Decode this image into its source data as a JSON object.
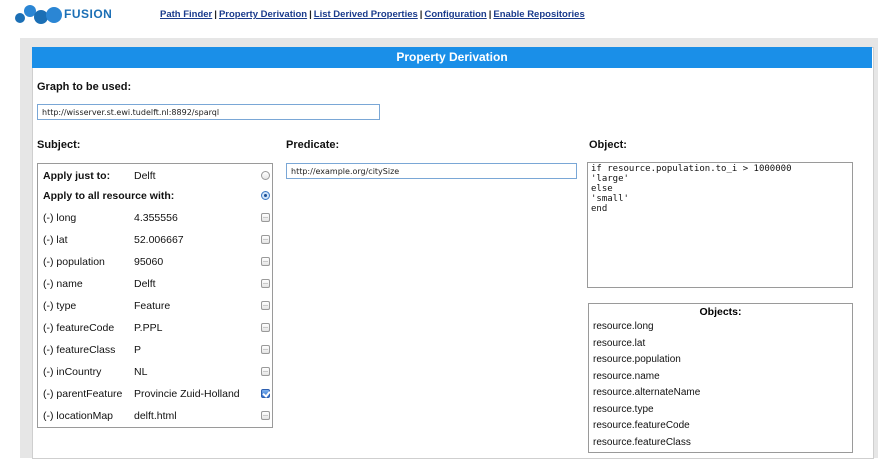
{
  "app": {
    "logo_text": "FUSION",
    "brand_color": "#1b6fb5"
  },
  "nav": {
    "items": [
      {
        "label": "Path Finder"
      },
      {
        "label": "Property Derivation"
      },
      {
        "label": "List Derived Properties"
      },
      {
        "label": "Configuration"
      },
      {
        "label": "Enable Repositories"
      }
    ],
    "separator": "|"
  },
  "panel": {
    "title": "Property Derivation",
    "accent": "#1a8fe8"
  },
  "graph": {
    "label": "Graph to be used:",
    "value": "http://wisserver.st.ewi.tudelft.nl:8892/sparql"
  },
  "subject": {
    "label": "Subject:",
    "apply_just_to": {
      "label": "Apply just to:",
      "value": "Delft",
      "selected": false
    },
    "apply_all": {
      "label": "Apply to all resource with:",
      "selected": true
    },
    "properties": [
      {
        "key": "(-) long",
        "value": "4.355556",
        "checked": false
      },
      {
        "key": "(-) lat",
        "value": "52.006667",
        "checked": false
      },
      {
        "key": "(-) population",
        "value": "95060",
        "checked": false
      },
      {
        "key": "(-) name",
        "value": "Delft",
        "checked": false
      },
      {
        "key": "(-) type",
        "value": "Feature",
        "checked": false
      },
      {
        "key": "(-) featureCode",
        "value": "P.PPL",
        "checked": false
      },
      {
        "key": "(-) featureClass",
        "value": "P",
        "checked": false
      },
      {
        "key": "(-) inCountry",
        "value": "NL",
        "checked": false
      },
      {
        "key": "(-) parentFeature",
        "value": "Provincie Zuid-Holland",
        "checked": true
      },
      {
        "key": "(-) locationMap",
        "value": "delft.html",
        "checked": false
      }
    ]
  },
  "predicate": {
    "label": "Predicate:",
    "value": "http://example.org/citySize"
  },
  "object": {
    "label": "Object:",
    "code": "if resource.population.to_i > 1000000\n'large'\nelse\n'small'\nend",
    "list_header": "Objects:",
    "list": [
      "resource.long",
      "resource.lat",
      "resource.population",
      "resource.name",
      "resource.alternateName",
      "resource.type",
      "resource.featureCode",
      "resource.featureClass"
    ]
  }
}
